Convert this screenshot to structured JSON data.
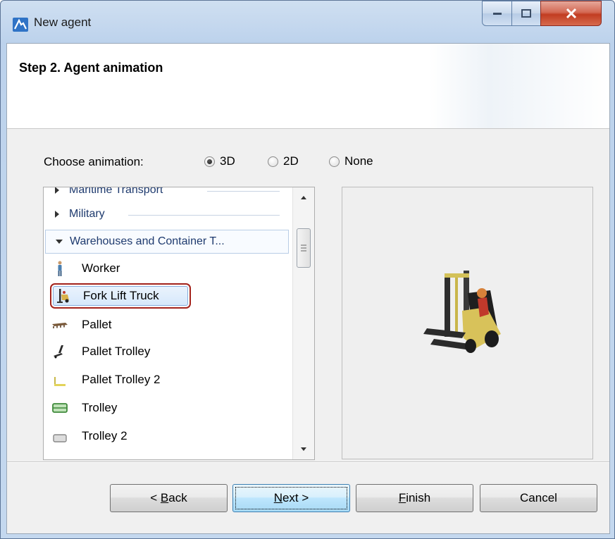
{
  "window": {
    "title": "New agent",
    "controls": {
      "minimize": "minimize",
      "maximize": "maximize",
      "close": "close"
    }
  },
  "header": {
    "step_title": "Step 2. Agent animation"
  },
  "animation": {
    "label": "Choose animation:",
    "options": [
      {
        "label": "3D",
        "selected": true
      },
      {
        "label": "2D",
        "selected": false
      },
      {
        "label": "None",
        "selected": false
      }
    ]
  },
  "list": {
    "categories": [
      {
        "label": "Maritime Transport",
        "expanded": false
      },
      {
        "label": "Military",
        "expanded": false
      },
      {
        "label": "Warehouses and Container T...",
        "expanded": true
      }
    ],
    "items": [
      {
        "label": "Worker",
        "icon": "worker-icon"
      },
      {
        "label": "Fork Lift Truck",
        "icon": "fork-lift-truck-icon",
        "selected": true
      },
      {
        "label": "Pallet",
        "icon": "pallet-icon"
      },
      {
        "label": "Pallet Trolley",
        "icon": "pallet-trolley-icon"
      },
      {
        "label": "Pallet Trolley 2",
        "icon": "pallet-trolley-2-icon"
      },
      {
        "label": "Trolley",
        "icon": "trolley-icon"
      },
      {
        "label": "Trolley 2",
        "icon": "trolley-2-icon"
      }
    ]
  },
  "preview": {
    "icon": "fork-lift-truck-3d-preview"
  },
  "buttons": {
    "back": {
      "prefix": "< ",
      "mnemonic": "B",
      "rest": "ack"
    },
    "next": {
      "mnemonic": "N",
      "rest": "ext >"
    },
    "finish": {
      "mnemonic": "F",
      "rest": "inish"
    },
    "cancel": {
      "label": "Cancel"
    }
  }
}
